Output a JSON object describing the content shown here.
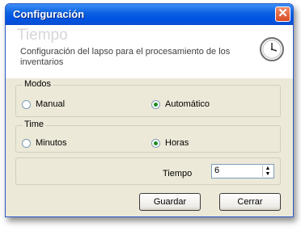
{
  "window": {
    "title": "Configuración",
    "close_icon": "close-icon"
  },
  "header": {
    "title": "Tiempo",
    "description": "Configuración del lapso para el procesamiento de los inventarios",
    "icon": "clock-icon"
  },
  "modos": {
    "legend": "Modos",
    "options": [
      {
        "label": "Manual",
        "selected": false
      },
      {
        "label": "Automático",
        "selected": true
      }
    ]
  },
  "time": {
    "legend": "Time",
    "options": [
      {
        "label": "Minutos",
        "selected": false
      },
      {
        "label": "Horas",
        "selected": true
      }
    ]
  },
  "tiempo": {
    "label": "Tiempo",
    "value": "6"
  },
  "buttons": {
    "save": "Guardar",
    "close": "Cerrar"
  }
}
